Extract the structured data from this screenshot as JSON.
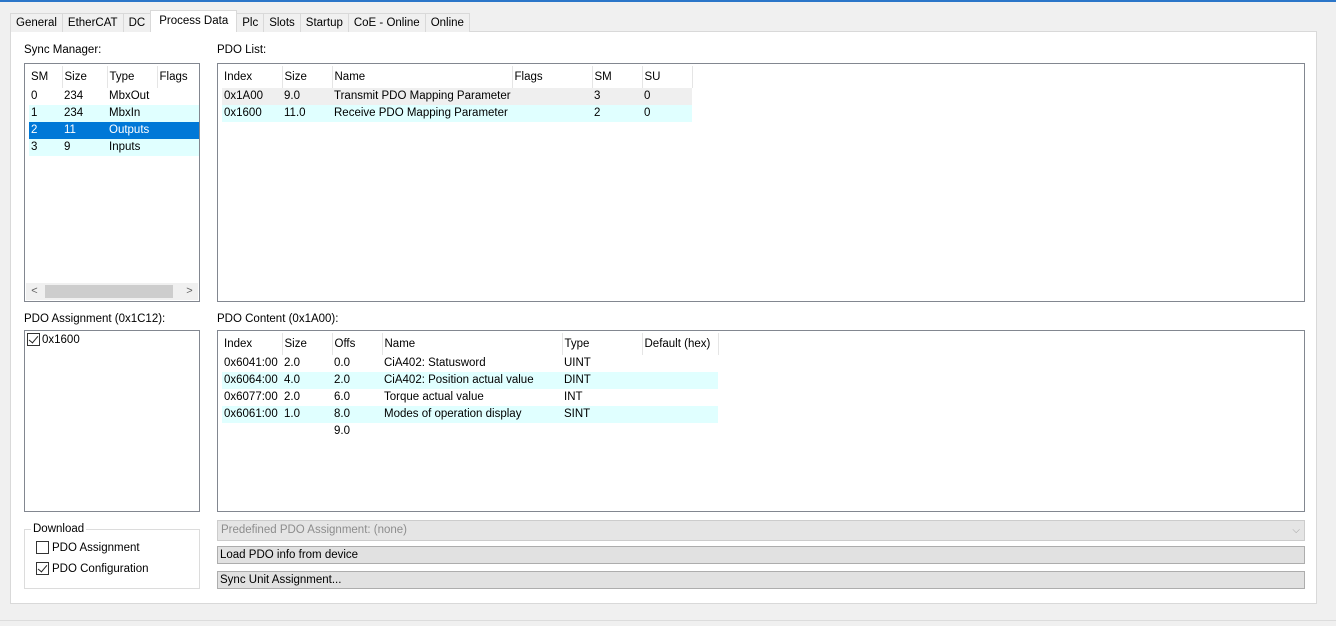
{
  "tabs": [
    {
      "label": "General"
    },
    {
      "label": "EtherCAT"
    },
    {
      "label": "DC"
    },
    {
      "label": "Process Data"
    },
    {
      "label": "Plc"
    },
    {
      "label": "Slots"
    },
    {
      "label": "Startup"
    },
    {
      "label": "CoE - Online"
    },
    {
      "label": "Online"
    }
  ],
  "sync_manager": {
    "title": "Sync Manager:",
    "columns": [
      "SM",
      "Size",
      "Type",
      "Flags"
    ],
    "rows": [
      {
        "sm": "0",
        "size": "234",
        "type": "MbxOut",
        "flags": ""
      },
      {
        "sm": "1",
        "size": "234",
        "type": "MbxIn",
        "flags": ""
      },
      {
        "sm": "2",
        "size": "11",
        "type": "Outputs",
        "flags": ""
      },
      {
        "sm": "3",
        "size": "9",
        "type": "Inputs",
        "flags": ""
      }
    ],
    "scroll_left": "<",
    "scroll_right": ">"
  },
  "pdo_list": {
    "title": "PDO List:",
    "columns": [
      "Index",
      "Size",
      "Name",
      "Flags",
      "SM",
      "SU"
    ],
    "rows": [
      {
        "index": "0x1A00",
        "size": "9.0",
        "name": "Transmit PDO Mapping Parameter",
        "flags": "",
        "sm": "3",
        "su": "0"
      },
      {
        "index": "0x1600",
        "size": "11.0",
        "name": "Receive PDO Mapping Parameter",
        "flags": "",
        "sm": "2",
        "su": "0"
      }
    ]
  },
  "pdo_assignment": {
    "title": "PDO Assignment (0x1C12):",
    "items": [
      {
        "label": "0x1600",
        "checked": true
      }
    ]
  },
  "pdo_content": {
    "title": "PDO Content (0x1A00):",
    "columns": [
      "Index",
      "Size",
      "Offs",
      "Name",
      "Type",
      "Default (hex)"
    ],
    "rows": [
      {
        "index": "0x6041:00",
        "size": "2.0",
        "offs": "0.0",
        "name": "CiA402: Statusword",
        "type": "UINT",
        "default": ""
      },
      {
        "index": "0x6064:00",
        "size": "4.0",
        "offs": "2.0",
        "name": "CiA402: Position actual value",
        "type": "DINT",
        "default": ""
      },
      {
        "index": "0x6077:00",
        "size": "2.0",
        "offs": "6.0",
        "name": "Torque actual value",
        "type": "INT",
        "default": ""
      },
      {
        "index": "0x6061:00",
        "size": "1.0",
        "offs": "8.0",
        "name": "Modes of operation display",
        "type": "SINT",
        "default": ""
      },
      {
        "index": "",
        "size": "",
        "offs": "9.0",
        "name": "",
        "type": "",
        "default": ""
      }
    ]
  },
  "download": {
    "title": "Download",
    "pdo_assignment": {
      "label": "PDO Assignment",
      "checked": false
    },
    "pdo_configuration": {
      "label": "PDO Configuration",
      "checked": true
    }
  },
  "predefined": {
    "value": "Predefined PDO Assignment: (none)",
    "arrow": "⌵"
  },
  "buttons": {
    "load_pdo": "Load PDO info from device",
    "sync_unit": "Sync Unit Assignment..."
  }
}
